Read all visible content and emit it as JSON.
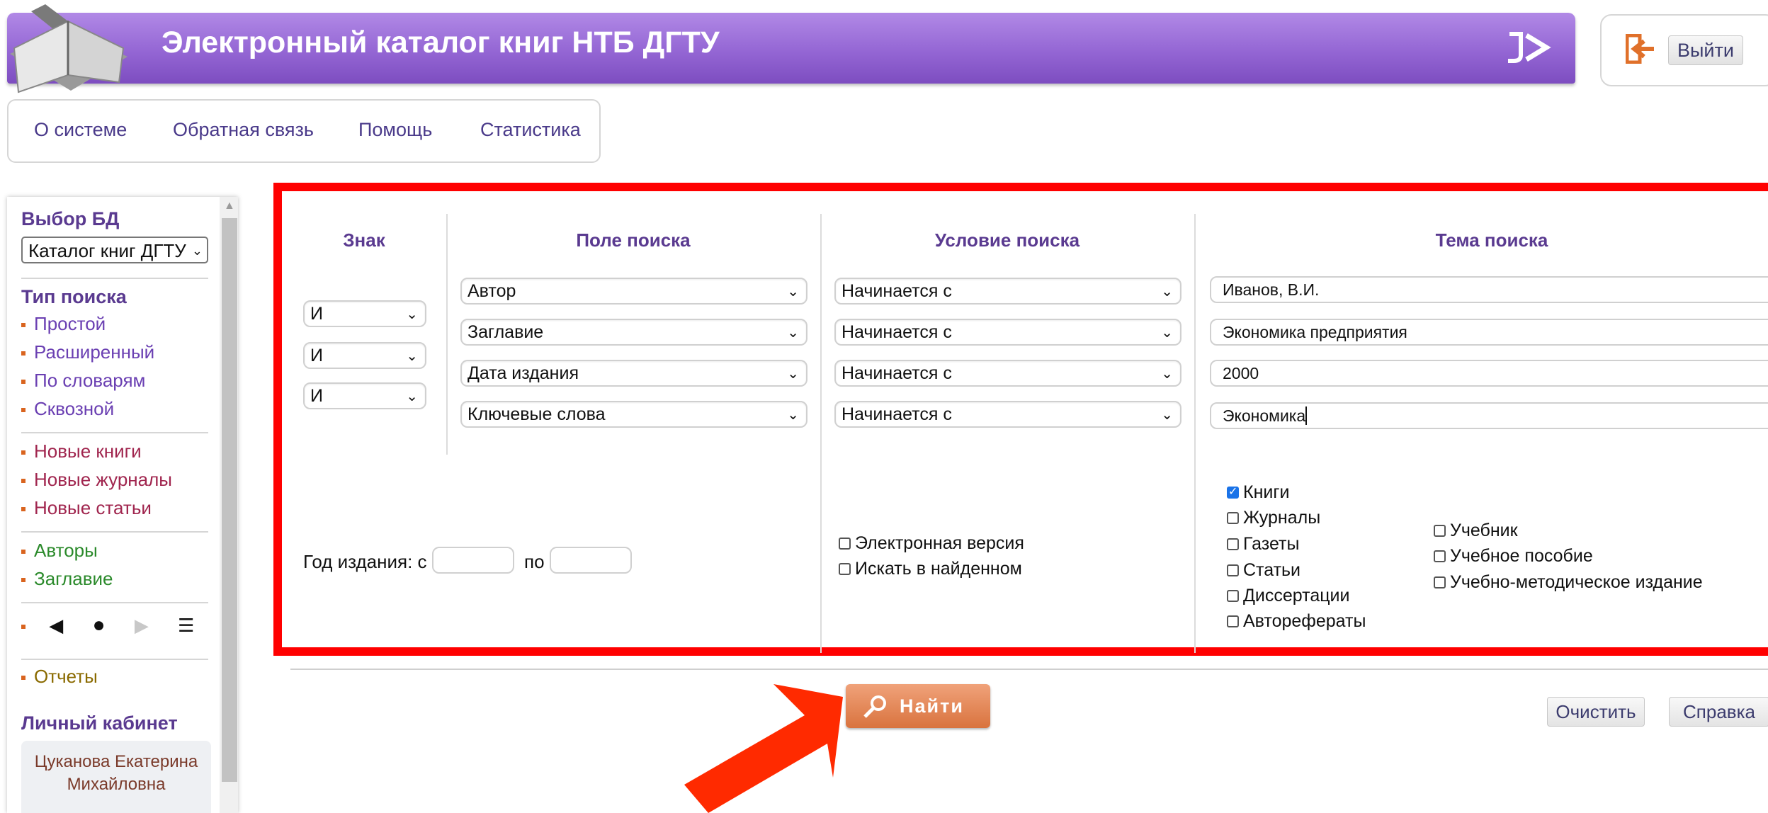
{
  "header": {
    "title": "Электронный каталог книг НТБ ДГТУ",
    "logout_label": "Выйти"
  },
  "topmenu": [
    "О системе",
    "Обратная связь",
    "Помощь",
    "Статистика"
  ],
  "sidebar": {
    "db_heading": "Выбор БД",
    "db_selected": "Каталог книг ДГТУ",
    "search_type_heading": "Тип поиска",
    "search_types": [
      "Простой",
      "Расширенный",
      "По словарям",
      "Сквозной"
    ],
    "new_items": [
      "Новые книги",
      "Новые журналы",
      "Новые статьи"
    ],
    "index_items": [
      "Авторы",
      "Заглавие"
    ],
    "reports": "Отчеты",
    "cabinet_heading": "Личный кабинет",
    "user_name_line1": "Цуканова Екатерина",
    "user_name_line2": "Михайловна"
  },
  "form": {
    "headers": {
      "sign": "Знак",
      "field": "Поле поиска",
      "condition": "Условие поиска",
      "topic": "Тема поиска"
    },
    "signs": [
      "И",
      "И",
      "И"
    ],
    "fields": [
      "Автор",
      "Заглавие",
      "Дата издания",
      "Ключевые слова"
    ],
    "conditions": [
      "Начинается с",
      "Начинается с",
      "Начинается с",
      "Начинается с"
    ],
    "topics": [
      "Иванов, В.И.",
      "Экономика предприятия",
      "2000",
      "Экономика"
    ],
    "year_from_label": "Год издания: с",
    "year_to_label": "по",
    "options": [
      {
        "label": "Электронная версия",
        "checked": false
      },
      {
        "label": "Искать в найденном",
        "checked": false
      }
    ],
    "doc_types": [
      {
        "label": "Книги",
        "checked": true
      },
      {
        "label": "Журналы",
        "checked": false
      },
      {
        "label": "Газеты",
        "checked": false
      },
      {
        "label": "Статьи",
        "checked": false
      },
      {
        "label": "Диссертации",
        "checked": false
      },
      {
        "label": "Авторефераты",
        "checked": false
      }
    ],
    "pub_types": [
      {
        "label": "Учебник",
        "checked": false
      },
      {
        "label": "Учебное пособие",
        "checked": false
      },
      {
        "label": "Учебно-методическое издание",
        "checked": false
      }
    ]
  },
  "actions": {
    "find": "Найти",
    "clear": "Очистить",
    "help": "Справка"
  },
  "colors": {
    "header": "#9466d4",
    "highlight_border": "#ff0000",
    "find_button": "#d9733e",
    "annotation_arrow": "#ff2a00"
  }
}
